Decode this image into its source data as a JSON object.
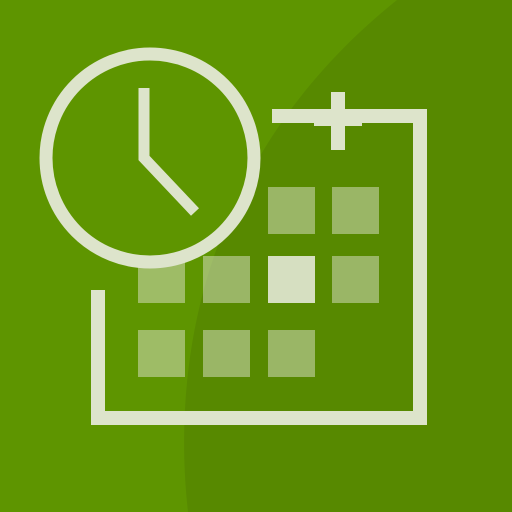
{
  "app_tile": {
    "icon": "calendar-clock-icon",
    "colors": {
      "background": "#5e9500",
      "background_shadow": "#578900",
      "glyph": "#dde4cb"
    },
    "clock": {
      "time_shown": "4:00"
    },
    "calendar": {
      "rows": 3,
      "columns": 4,
      "highlighted_day": {
        "row": 2,
        "column": 3
      }
    }
  }
}
